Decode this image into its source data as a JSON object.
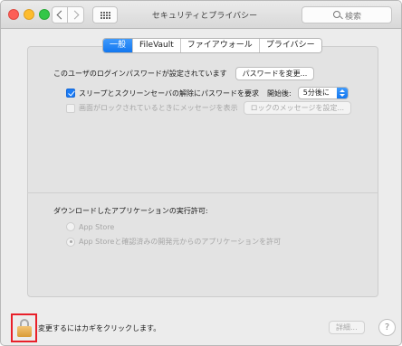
{
  "window": {
    "title": "セキュリティとプライバシー"
  },
  "search": {
    "placeholder": "検索"
  },
  "tabs": [
    {
      "label": "一般",
      "active": true
    },
    {
      "label": "FileVault",
      "active": false
    },
    {
      "label": "ファイアウォール",
      "active": false
    },
    {
      "label": "プライバシー",
      "active": false
    }
  ],
  "general": {
    "password_text": "このユーザのログインパスワードが設定されています",
    "change_password_button": "パスワードを変更...",
    "require_password_label": "スリープとスクリーンセーバの解除にパスワードを要求",
    "require_password_checked": true,
    "start_label": "開始後:",
    "start_value": "5分後に",
    "lock_message_label": "画面がロックされているときにメッセージを表示",
    "lock_message_checked": false,
    "lock_message_button": "ロックのメッセージを設定..."
  },
  "download": {
    "heading": "ダウンロードしたアプリケーションの実行許可:",
    "options": [
      {
        "label": "App Store",
        "selected": false
      },
      {
        "label": "App Storeと確認済みの開発元からのアプリケーションを許可",
        "selected": true
      }
    ]
  },
  "footer": {
    "lock_text": "変更するにはカギをクリックします。",
    "details_button": "詳細...",
    "help_label": "?"
  },
  "icons": {
    "back": "chevron-left-icon",
    "forward": "chevron-right-icon",
    "grid": "grid-icon",
    "search": "search-icon",
    "lock": "lock-icon"
  },
  "colors": {
    "accent": "#1b7cf6",
    "highlight_box": "#e8202a",
    "close": "#fc5f57",
    "minimize": "#fdbc2e",
    "zoom": "#33c748"
  }
}
